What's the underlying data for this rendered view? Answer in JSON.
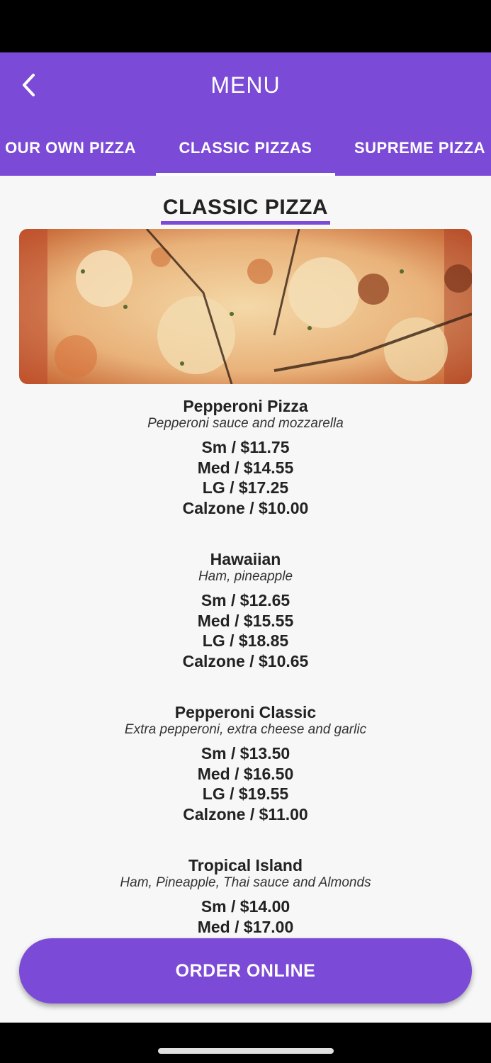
{
  "header": {
    "title": "MENU",
    "back_icon": "chevron-left-icon"
  },
  "tabs": [
    {
      "label": "OUR OWN PIZZA"
    },
    {
      "label": "CLASSIC PIZZAS"
    },
    {
      "label": "SUPREME PIZZA"
    }
  ],
  "selected_tab": "CLASSIC PIZZAS",
  "section": {
    "heading": "CLASSIC PIZZA"
  },
  "items": [
    {
      "name": "Pepperoni Pizza",
      "description": "Pepperoni sauce and mozzarella",
      "prices": [
        "Sm / $11.75",
        "Med / $14.55",
        "LG / $17.25",
        "Calzone / $10.00"
      ]
    },
    {
      "name": "Hawaiian",
      "description": "Ham, pineapple",
      "prices": [
        "Sm / $12.65",
        "Med / $15.55",
        "LG / $18.85",
        "Calzone / $10.65"
      ]
    },
    {
      "name": "Pepperoni Classic",
      "description": "Extra pepperoni, extra cheese and garlic",
      "prices": [
        "Sm / $13.50",
        "Med / $16.50",
        "LG / $19.55",
        "Calzone / $11.00"
      ]
    },
    {
      "name": "Tropical Island",
      "description": "Ham, Pineapple, Thai sauce and Almonds",
      "prices": [
        "Sm / $14.00",
        "Med / $17.00"
      ]
    }
  ],
  "order_button": {
    "label": "ORDER ONLINE"
  },
  "colors": {
    "accent": "#7b4ad6",
    "background": "#f7f7f7",
    "text": "#222222"
  }
}
